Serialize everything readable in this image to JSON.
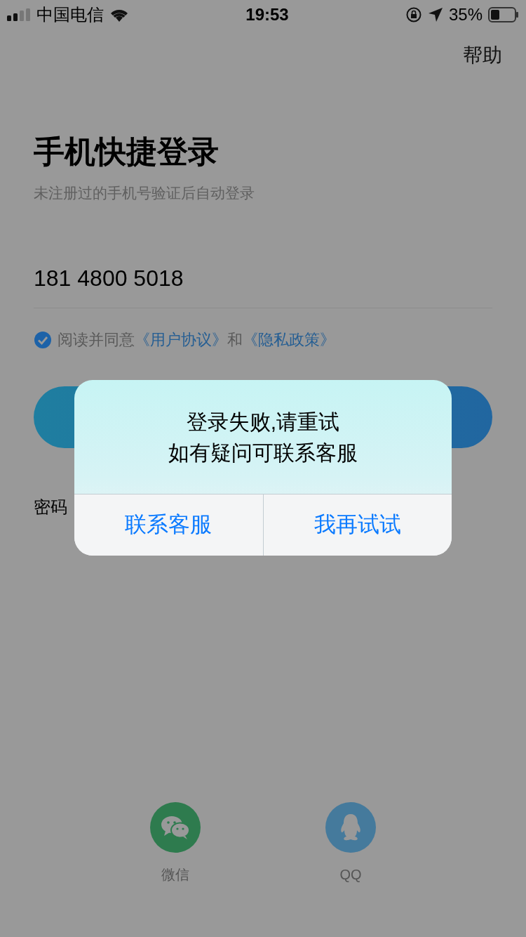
{
  "status_bar": {
    "carrier": "中国电信",
    "time": "19:53",
    "battery": "35%"
  },
  "help": "帮助",
  "title": "手机快捷登录",
  "subtitle": "未注册过的手机号验证后自动登录",
  "phone": {
    "value": "181 4800 5018"
  },
  "agreement": {
    "checked": true,
    "parts": [
      {
        "kind": "text",
        "text": "阅读并同意"
      },
      {
        "kind": "link",
        "text": "《用户协议》"
      },
      {
        "kind": "text",
        "text": "和"
      },
      {
        "kind": "link",
        "text": "《隐私政策》"
      }
    ]
  },
  "password_login": "密码",
  "social": [
    {
      "kind": "wechat",
      "label": "微信"
    },
    {
      "kind": "qq",
      "label": "QQ"
    }
  ],
  "dialog": {
    "message_lines": [
      "登录失败,请重试",
      "如有疑问可联系客服"
    ],
    "buttons": [
      "联系客服",
      "我再试试"
    ]
  }
}
